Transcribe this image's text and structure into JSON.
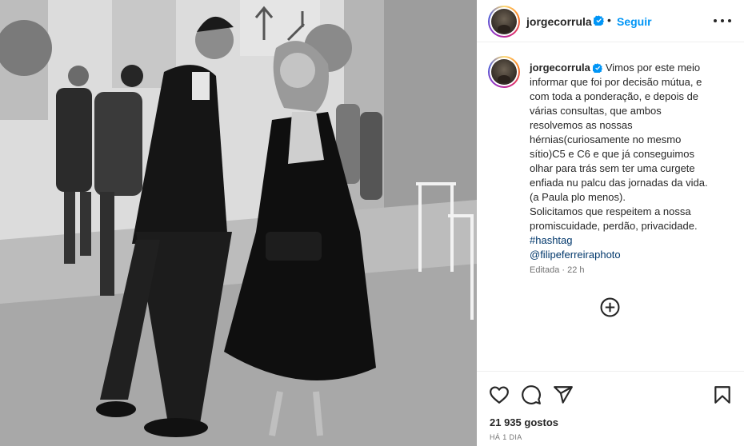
{
  "header": {
    "username": "jorgecorrula",
    "separator": "•",
    "follow_label": "Seguir",
    "icons": {
      "verified": "verified-badge-icon",
      "more": "more-options-icon"
    }
  },
  "caption": {
    "username": "jorgecorrula",
    "lines": [
      "Vimos por este meio",
      "informar que foi por decisão mútua, e",
      "com toda a ponderação, e depois de",
      "várias consultas, que ambos",
      "resolvemos as nossas",
      "hérnias(curiosamente no mesmo",
      "sítio)C5 e C6 e que já conseguimos",
      "olhar para trás sem ter uma curgete",
      "enfiada nu palcu das jornadas da vida.",
      "(a Paula plo menos).",
      "Solicitamos que respeitem a nossa",
      "promiscuidade, perdão, privacidade."
    ],
    "hashtag": "#hashtag",
    "mention": "@filipeferreiraphoto",
    "edited": "Editada · 22 h"
  },
  "actions": {
    "icons": [
      "heart-icon",
      "comment-icon",
      "share-icon",
      "bookmark-icon",
      "load-more-comments-icon"
    ],
    "likes": "21 935 gostos",
    "time": "HÁ 1 DIA"
  },
  "colors": {
    "accent": "#0095f6",
    "link": "#00376b",
    "text": "#262626",
    "secondary": "#737373"
  }
}
